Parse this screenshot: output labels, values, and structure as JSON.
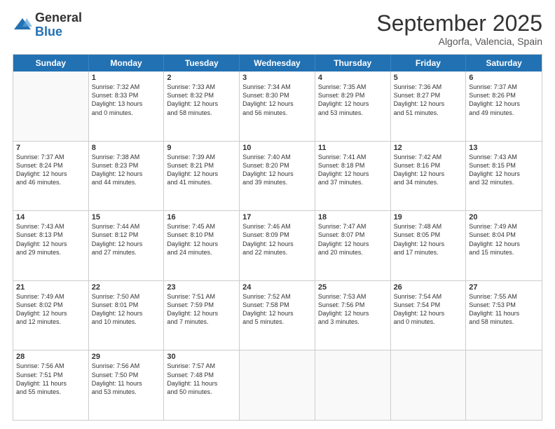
{
  "logo": {
    "general": "General",
    "blue": "Blue"
  },
  "title": "September 2025",
  "subtitle": "Algorfa, Valencia, Spain",
  "days": [
    "Sunday",
    "Monday",
    "Tuesday",
    "Wednesday",
    "Thursday",
    "Friday",
    "Saturday"
  ],
  "weeks": [
    [
      {
        "day": "",
        "info": ""
      },
      {
        "day": "1",
        "info": "Sunrise: 7:32 AM\nSunset: 8:33 PM\nDaylight: 13 hours\nand 0 minutes."
      },
      {
        "day": "2",
        "info": "Sunrise: 7:33 AM\nSunset: 8:32 PM\nDaylight: 12 hours\nand 58 minutes."
      },
      {
        "day": "3",
        "info": "Sunrise: 7:34 AM\nSunset: 8:30 PM\nDaylight: 12 hours\nand 56 minutes."
      },
      {
        "day": "4",
        "info": "Sunrise: 7:35 AM\nSunset: 8:29 PM\nDaylight: 12 hours\nand 53 minutes."
      },
      {
        "day": "5",
        "info": "Sunrise: 7:36 AM\nSunset: 8:27 PM\nDaylight: 12 hours\nand 51 minutes."
      },
      {
        "day": "6",
        "info": "Sunrise: 7:37 AM\nSunset: 8:26 PM\nDaylight: 12 hours\nand 49 minutes."
      }
    ],
    [
      {
        "day": "7",
        "info": "Sunrise: 7:37 AM\nSunset: 8:24 PM\nDaylight: 12 hours\nand 46 minutes."
      },
      {
        "day": "8",
        "info": "Sunrise: 7:38 AM\nSunset: 8:23 PM\nDaylight: 12 hours\nand 44 minutes."
      },
      {
        "day": "9",
        "info": "Sunrise: 7:39 AM\nSunset: 8:21 PM\nDaylight: 12 hours\nand 41 minutes."
      },
      {
        "day": "10",
        "info": "Sunrise: 7:40 AM\nSunset: 8:20 PM\nDaylight: 12 hours\nand 39 minutes."
      },
      {
        "day": "11",
        "info": "Sunrise: 7:41 AM\nSunset: 8:18 PM\nDaylight: 12 hours\nand 37 minutes."
      },
      {
        "day": "12",
        "info": "Sunrise: 7:42 AM\nSunset: 8:16 PM\nDaylight: 12 hours\nand 34 minutes."
      },
      {
        "day": "13",
        "info": "Sunrise: 7:43 AM\nSunset: 8:15 PM\nDaylight: 12 hours\nand 32 minutes."
      }
    ],
    [
      {
        "day": "14",
        "info": "Sunrise: 7:43 AM\nSunset: 8:13 PM\nDaylight: 12 hours\nand 29 minutes."
      },
      {
        "day": "15",
        "info": "Sunrise: 7:44 AM\nSunset: 8:12 PM\nDaylight: 12 hours\nand 27 minutes."
      },
      {
        "day": "16",
        "info": "Sunrise: 7:45 AM\nSunset: 8:10 PM\nDaylight: 12 hours\nand 24 minutes."
      },
      {
        "day": "17",
        "info": "Sunrise: 7:46 AM\nSunset: 8:09 PM\nDaylight: 12 hours\nand 22 minutes."
      },
      {
        "day": "18",
        "info": "Sunrise: 7:47 AM\nSunset: 8:07 PM\nDaylight: 12 hours\nand 20 minutes."
      },
      {
        "day": "19",
        "info": "Sunrise: 7:48 AM\nSunset: 8:05 PM\nDaylight: 12 hours\nand 17 minutes."
      },
      {
        "day": "20",
        "info": "Sunrise: 7:49 AM\nSunset: 8:04 PM\nDaylight: 12 hours\nand 15 minutes."
      }
    ],
    [
      {
        "day": "21",
        "info": "Sunrise: 7:49 AM\nSunset: 8:02 PM\nDaylight: 12 hours\nand 12 minutes."
      },
      {
        "day": "22",
        "info": "Sunrise: 7:50 AM\nSunset: 8:01 PM\nDaylight: 12 hours\nand 10 minutes."
      },
      {
        "day": "23",
        "info": "Sunrise: 7:51 AM\nSunset: 7:59 PM\nDaylight: 12 hours\nand 7 minutes."
      },
      {
        "day": "24",
        "info": "Sunrise: 7:52 AM\nSunset: 7:58 PM\nDaylight: 12 hours\nand 5 minutes."
      },
      {
        "day": "25",
        "info": "Sunrise: 7:53 AM\nSunset: 7:56 PM\nDaylight: 12 hours\nand 3 minutes."
      },
      {
        "day": "26",
        "info": "Sunrise: 7:54 AM\nSunset: 7:54 PM\nDaylight: 12 hours\nand 0 minutes."
      },
      {
        "day": "27",
        "info": "Sunrise: 7:55 AM\nSunset: 7:53 PM\nDaylight: 11 hours\nand 58 minutes."
      }
    ],
    [
      {
        "day": "28",
        "info": "Sunrise: 7:56 AM\nSunset: 7:51 PM\nDaylight: 11 hours\nand 55 minutes."
      },
      {
        "day": "29",
        "info": "Sunrise: 7:56 AM\nSunset: 7:50 PM\nDaylight: 11 hours\nand 53 minutes."
      },
      {
        "day": "30",
        "info": "Sunrise: 7:57 AM\nSunset: 7:48 PM\nDaylight: 11 hours\nand 50 minutes."
      },
      {
        "day": "",
        "info": ""
      },
      {
        "day": "",
        "info": ""
      },
      {
        "day": "",
        "info": ""
      },
      {
        "day": "",
        "info": ""
      }
    ]
  ]
}
